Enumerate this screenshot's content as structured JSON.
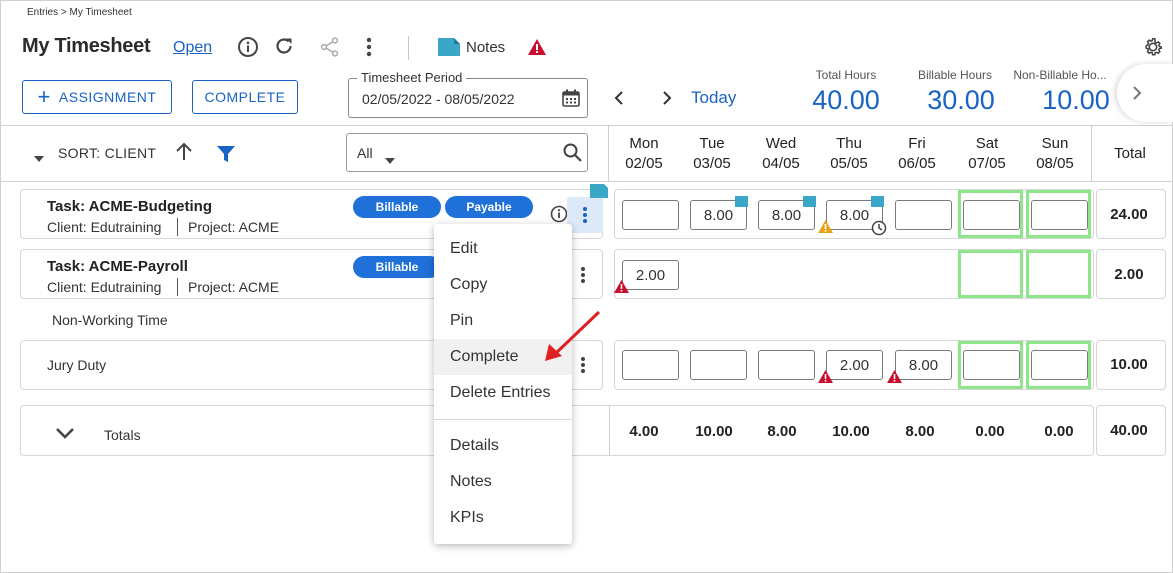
{
  "breadcrumb": "Entries > My Timesheet",
  "header": {
    "title": "My Timesheet",
    "status": "Open",
    "notes_label": "Notes"
  },
  "toolbar": {
    "assignment_label": "ASSIGNMENT",
    "complete_label": "COMPLETE",
    "period_label": "Timesheet Period",
    "period_value": "02/05/2022 - 08/05/2022",
    "today_label": "Today"
  },
  "kpis": [
    {
      "label": "Total Hours",
      "value": "40.00"
    },
    {
      "label": "Billable Hours",
      "value": "30.00"
    },
    {
      "label": "Non-Billable Ho...",
      "value": "10.00"
    }
  ],
  "list_controls": {
    "sort_label": "SORT: CLIENT",
    "filter_value": "All"
  },
  "days": [
    {
      "name": "Mon",
      "date": "02/05"
    },
    {
      "name": "Tue",
      "date": "03/05"
    },
    {
      "name": "Wed",
      "date": "04/05"
    },
    {
      "name": "Thu",
      "date": "05/05"
    },
    {
      "name": "Fri",
      "date": "06/05"
    },
    {
      "name": "Sat",
      "date": "07/05"
    },
    {
      "name": "Sun",
      "date": "08/05"
    }
  ],
  "total_header": "Total",
  "rows": [
    {
      "task": "Task: ACME-Budgeting",
      "client": "Client: Edutraining",
      "project": "Project: ACME",
      "badges": [
        "Billable",
        "Payable"
      ],
      "hours": [
        "",
        "8.00",
        "8.00",
        "8.00",
        "",
        "",
        ""
      ],
      "total": "24.00"
    },
    {
      "task": "Task: ACME-Payroll",
      "client": "Client: Edutraining",
      "project": "Project: ACME",
      "badges": [
        "Billable"
      ],
      "hours": [
        "2.00",
        "",
        "",
        "",
        "",
        "",
        ""
      ],
      "total": "2.00"
    },
    {
      "task": "Jury Duty",
      "hours": [
        "",
        "",
        "",
        "2.00",
        "8.00",
        "",
        ""
      ],
      "total": "10.00"
    }
  ],
  "non_working_label": "Non-Working Time",
  "totals": {
    "label": "Totals",
    "values": [
      "4.00",
      "10.00",
      "8.00",
      "10.00",
      "8.00",
      "0.00",
      "0.00"
    ],
    "grand_total": "40.00"
  },
  "context_menu": {
    "items": [
      "Edit",
      "Copy",
      "Pin",
      "Complete",
      "Delete Entries"
    ],
    "items2": [
      "Details",
      "Notes",
      "KPIs"
    ]
  },
  "colors": {
    "accent": "#1a62c4",
    "badge": "#1f70d9",
    "weekend_border": "#8ee68a",
    "error": "#c8102e",
    "warning": "#e8a317",
    "note_tag": "#3aa6c8",
    "annotation_arrow": "#e02020"
  }
}
